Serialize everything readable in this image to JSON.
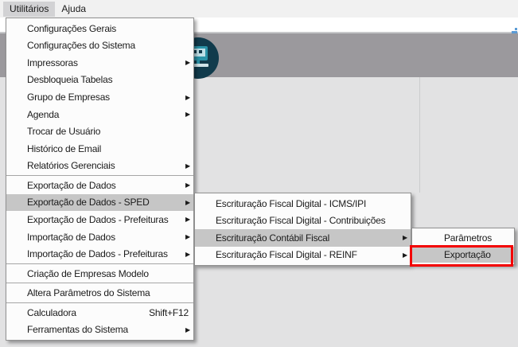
{
  "colors": {
    "banner": "#9b999d",
    "menubar-selected": "#d2d2d4",
    "menu-highlight": "#c6c6c6",
    "annotation-red": "#f30000",
    "logo-dark": "#113b4c",
    "logo-teal": "#2b93a8"
  },
  "menu_bar": {
    "items": [
      {
        "label": "Utilitários",
        "selected": true
      },
      {
        "label": "Ajuda",
        "selected": false
      }
    ]
  },
  "utilities_menu": {
    "items": [
      {
        "name": "configuracoes-gerais",
        "label": "Configurações Gerais"
      },
      {
        "name": "configuracoes-do-sistema",
        "label": "Configurações do Sistema"
      },
      {
        "name": "impressoras",
        "label": "Impressoras",
        "submenu": true
      },
      {
        "name": "desbloqueia-tabelas",
        "label": "Desbloqueia Tabelas"
      },
      {
        "name": "grupo-de-empresas",
        "label": "Grupo de Empresas",
        "submenu": true
      },
      {
        "name": "agenda",
        "label": "Agenda",
        "submenu": true
      },
      {
        "name": "trocar-de-usuario",
        "label": "Trocar de Usuário"
      },
      {
        "name": "historico-de-email",
        "label": "Histórico de Email"
      },
      {
        "name": "relatorios-gerenciais",
        "label": "Relatórios Gerenciais",
        "submenu": true
      },
      {
        "type": "separator"
      },
      {
        "name": "exportacao-de-dados",
        "label": "Exportação de Dados",
        "submenu": true
      },
      {
        "name": "exportacao-de-dados-sped",
        "label": "Exportação de Dados - SPED",
        "submenu": true,
        "highlighted": true
      },
      {
        "name": "exportacao-de-dados-prefeituras",
        "label": "Exportação de Dados - Prefeituras",
        "submenu": true
      },
      {
        "name": "importacao-de-dados",
        "label": "Importação de Dados",
        "submenu": true
      },
      {
        "name": "importacao-de-dados-prefeituras",
        "label": "Importação de Dados - Prefeituras",
        "submenu": true
      },
      {
        "type": "separator"
      },
      {
        "name": "criacao-de-empresas-modelo",
        "label": "Criação de Empresas Modelo"
      },
      {
        "type": "separator"
      },
      {
        "name": "altera-parametros-do-sistema",
        "label": "Altera Parâmetros do Sistema"
      },
      {
        "type": "separator"
      },
      {
        "name": "calculadora",
        "label": "Calculadora",
        "shortcut": "Shift+F12"
      },
      {
        "name": "ferramentas-do-sistema",
        "label": "Ferramentas do Sistema",
        "submenu": true
      }
    ]
  },
  "sped_submenu": {
    "items": [
      {
        "name": "escrituracao-fiscal-digital-icms-ipi",
        "label": "Escrituração Fiscal Digital - ICMS/IPI"
      },
      {
        "name": "escrituracao-fiscal-digital-contribuicoes",
        "label": "Escrituração Fiscal Digital - Contribuições"
      },
      {
        "name": "escrituracao-contabil-fiscal",
        "label": "Escrituração Contábil Fiscal",
        "submenu": true,
        "highlighted": true
      },
      {
        "name": "escrituracao-fiscal-digital-reinf",
        "label": "Escrituração Fiscal Digital - REINF",
        "submenu": true
      }
    ]
  },
  "ecf_submenu": {
    "items": [
      {
        "name": "parametros",
        "label": "Parâmetros"
      },
      {
        "name": "exportacao",
        "label": "Exportação",
        "highlighted": true,
        "annotated": true
      }
    ]
  }
}
